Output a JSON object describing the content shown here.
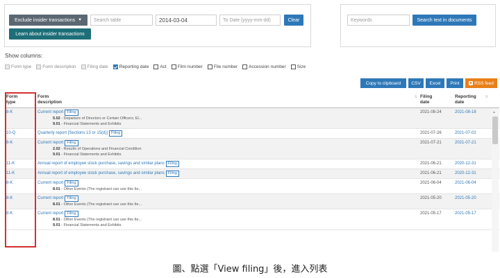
{
  "filters": {
    "exclude_label": "Exclude insider transactions",
    "learn_label": "Learn about insider transactions",
    "search_table_placeholder": "Search table",
    "from_date_value": "2014-03-04",
    "to_date_placeholder": "To Date (yyyy-mm-dd)",
    "clear_label": "Clear"
  },
  "keywords": {
    "placeholder": "Keywords",
    "search_docs_label": "Search text in documents"
  },
  "columns": {
    "label": "Show columns:",
    "options": [
      {
        "label": "Form type",
        "checked": true,
        "disabled": true
      },
      {
        "label": "Form description",
        "checked": true,
        "disabled": true
      },
      {
        "label": "Filing date",
        "checked": true,
        "disabled": true
      },
      {
        "label": "Reporting date",
        "checked": true,
        "disabled": false
      },
      {
        "label": "Act",
        "checked": false,
        "disabled": false
      },
      {
        "label": "Film number",
        "checked": false,
        "disabled": false
      },
      {
        "label": "File number",
        "checked": false,
        "disabled": false
      },
      {
        "label": "Accession number",
        "checked": false,
        "disabled": false
      },
      {
        "label": "Size",
        "checked": false,
        "disabled": false
      }
    ]
  },
  "toolbar": {
    "copy": "Copy to clipboard",
    "csv": "CSV",
    "excel": "Excel",
    "print": "Print",
    "rss": "RSS feed"
  },
  "table": {
    "headers": {
      "form_type_1": "Form",
      "form_type_2": "type",
      "desc_1": "Form",
      "desc_2": "description",
      "filing_1": "Filing",
      "filing_2": "date",
      "reporting_1": "Reporting",
      "reporting_2": "date"
    },
    "badge": "Filing",
    "rows": [
      {
        "type": "8-K",
        "desc": "Current report",
        "items": [
          {
            "code": "5.02",
            "text": "- Departure of Directors or Certain Officers; El..."
          },
          {
            "code": "9.01",
            "text": "- Financial Statements and Exhibits"
          }
        ],
        "filing": "2021-08-24",
        "reporting": "2021-08-18"
      },
      {
        "type": "10-Q",
        "desc": "Quarterly report [Sections 13 or 15(d)]",
        "items": [],
        "filing": "2021-07-26",
        "reporting": "2021-07-02"
      },
      {
        "type": "8-K",
        "desc": "Current report",
        "items": [
          {
            "code": "2.02",
            "text": "- Results of Operations and Financial Condition"
          },
          {
            "code": "9.01",
            "text": "- Financial Statements and Exhibits"
          }
        ],
        "filing": "2021-07-21",
        "reporting": "2021-07-21"
      },
      {
        "type": "11-K",
        "desc": "Annual report of employee stock purchase, savings and similar plans",
        "items": [],
        "filing": "2021-06-21",
        "reporting": "2020-12-31"
      },
      {
        "type": "11-K",
        "desc": "Annual report of employee stock purchase, savings and similar plans",
        "items": [],
        "filing": "2021-06-21",
        "reporting": "2020-12-31"
      },
      {
        "type": "8-K",
        "desc": "Current report",
        "items": [
          {
            "code": "8.01",
            "text": "- Other Events (The registrant can use this Ite..."
          }
        ],
        "filing": "2021-06-04",
        "reporting": "2021-06-04"
      },
      {
        "type": "8-K",
        "desc": "Current report",
        "items": [
          {
            "code": "8.01",
            "text": "- Other Events (The registrant can use this Ite..."
          }
        ],
        "filing": "2021-05-20",
        "reporting": "2021-05-20"
      },
      {
        "type": "8-K",
        "desc": "Current report",
        "items": [
          {
            "code": "8.01",
            "text": "- Other Events (The registrant can use this Ite..."
          },
          {
            "code": "9.01",
            "text": "- Financial Statements and Exhibits"
          }
        ],
        "filing": "2021-05-17",
        "reporting": "2021-05-17"
      }
    ]
  },
  "caption": "圖、點選「View filing」後，進入列表",
  "colors": {
    "link_blue": "#2e78b8",
    "teal": "#1d6e78",
    "dark_gray": "#5b6771",
    "rss_orange": "#e8801a",
    "highlight_red": "#d32f2f"
  }
}
